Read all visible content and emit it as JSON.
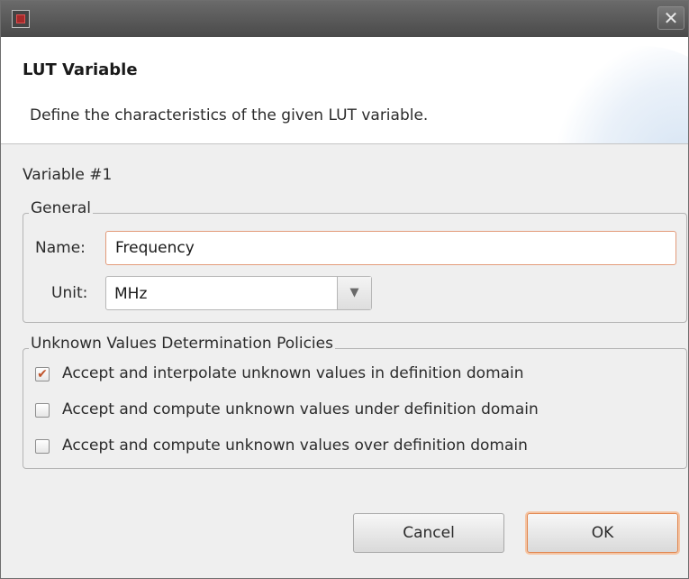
{
  "window": {
    "close_glyph": "✕",
    "app_icon": "app-window-icon"
  },
  "banner": {
    "title": "LUT Variable",
    "description": "Define the characteristics of the given LUT variable."
  },
  "variable_label": "Variable #1",
  "general": {
    "legend": "General",
    "name_label": "Name:",
    "name_value": "Frequency",
    "unit_label": "Unit:",
    "unit_value": "MHz"
  },
  "policies": {
    "legend": "Unknown Values Determination Policies",
    "options": [
      {
        "label": "Accept and interpolate unknown values in definition domain",
        "checked": true
      },
      {
        "label": "Accept and compute unknown values under definition domain",
        "checked": false
      },
      {
        "label": "Accept and compute unknown values over definition domain",
        "checked": false
      }
    ]
  },
  "buttons": {
    "cancel": "Cancel",
    "ok": "OK"
  },
  "colors": {
    "accent": "#e0864f",
    "check_mark": "#c0532a",
    "titlebar": "#4a4a4a"
  }
}
